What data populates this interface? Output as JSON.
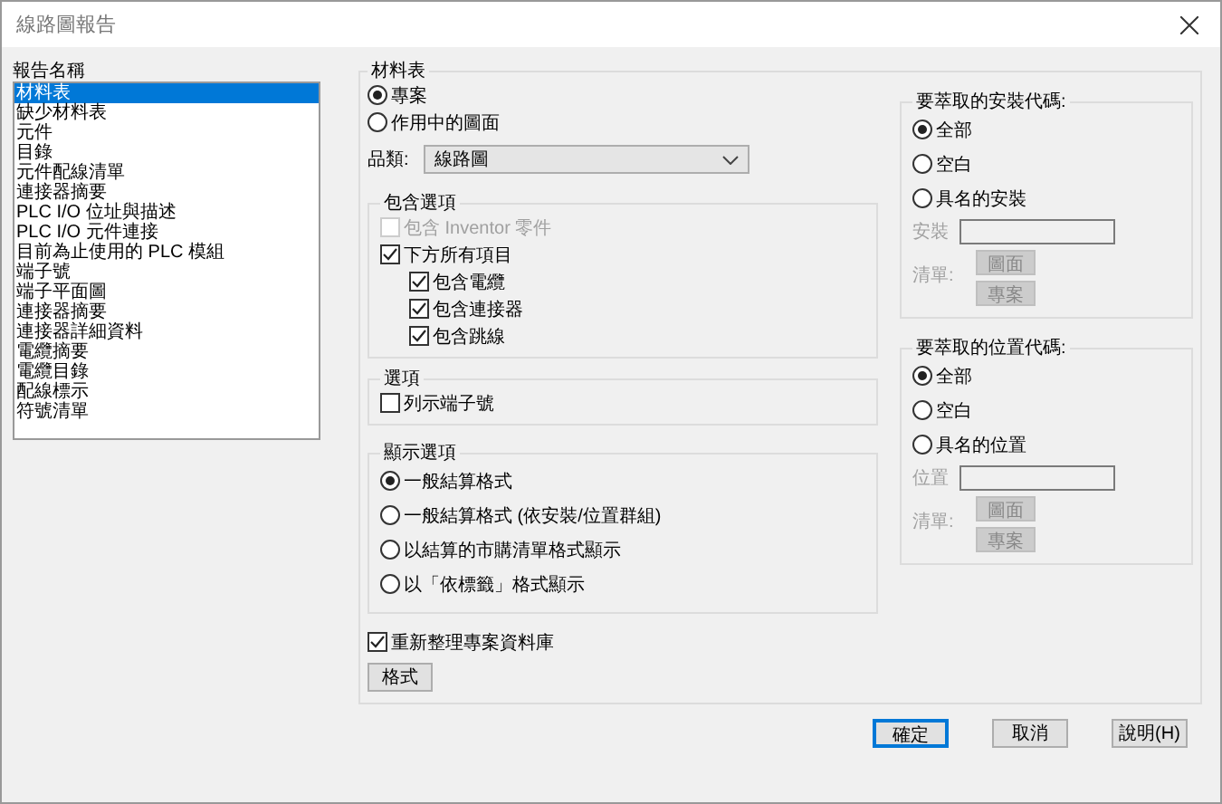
{
  "window": {
    "title": "線路圖報告"
  },
  "report_list": {
    "label": "報告名稱",
    "items": [
      {
        "label": "材料表",
        "selected": true
      },
      {
        "label": "缺少材料表",
        "selected": false
      },
      {
        "label": "元件",
        "selected": false
      },
      {
        "label": "目錄",
        "selected": false
      },
      {
        "label": "元件配線清單",
        "selected": false
      },
      {
        "label": "連接器摘要",
        "selected": false
      },
      {
        "label": "PLC I/O 位址與描述",
        "selected": false
      },
      {
        "label": "PLC I/O 元件連接",
        "selected": false
      },
      {
        "label": "目前為止使用的 PLC 模組",
        "selected": false
      },
      {
        "label": "端子號",
        "selected": false
      },
      {
        "label": "端子平面圖",
        "selected": false
      },
      {
        "label": "連接器摘要",
        "selected": false
      },
      {
        "label": "連接器詳細資料",
        "selected": false
      },
      {
        "label": "電纜摘要",
        "selected": false
      },
      {
        "label": "電纜目錄",
        "selected": false
      },
      {
        "label": "配線標示",
        "selected": false
      },
      {
        "label": "符號清單",
        "selected": false
      }
    ]
  },
  "bom": {
    "title": "材料表",
    "scope": [
      {
        "label": "專案",
        "selected": true
      },
      {
        "label": "作用中的圖面",
        "selected": false
      }
    ],
    "category": {
      "label": "品類:",
      "value": "線路圖"
    },
    "include": {
      "title": "包含選項",
      "items": [
        {
          "label": "包含 Inventor 零件",
          "checked": false,
          "disabled": true
        },
        {
          "label": "下方所有項目",
          "checked": true,
          "disabled": false,
          "children": [
            {
              "label": "包含電纜",
              "checked": true,
              "disabled": false
            },
            {
              "label": "包含連接器",
              "checked": true,
              "disabled": false
            },
            {
              "label": "包含跳線",
              "checked": true,
              "disabled": false
            }
          ]
        }
      ]
    },
    "options": {
      "title": "選項",
      "items": [
        {
          "label": "列示端子號",
          "checked": false
        }
      ]
    },
    "display": {
      "title": "顯示選項",
      "items": [
        {
          "label": "一般結算格式",
          "selected": true
        },
        {
          "label": "一般結算格式 (依安裝/位置群組)",
          "selected": false
        },
        {
          "label": "以結算的市購清單格式顯示",
          "selected": false
        },
        {
          "label": "以「依標籤」格式顯示",
          "selected": false
        }
      ]
    },
    "update_db": {
      "label": "重新整理專案資料庫",
      "checked": true
    },
    "format_button": "格式",
    "filters": [
      {
        "title": "要萃取的安裝代碼:",
        "choices": [
          {
            "label": "全部",
            "selected": true
          },
          {
            "label": "空白",
            "selected": false
          },
          {
            "label": "具名的安裝",
            "selected": false
          }
        ],
        "field_label": "安裝",
        "list_label": "清單:",
        "buttons": [
          "圖面",
          "專案"
        ],
        "disabled": true
      },
      {
        "title": "要萃取的位置代碼:",
        "choices": [
          {
            "label": "全部",
            "selected": true
          },
          {
            "label": "空白",
            "selected": false
          },
          {
            "label": "具名的位置",
            "selected": false
          }
        ],
        "field_label": "位置",
        "list_label": "清單:",
        "buttons": [
          "圖面",
          "專案"
        ],
        "disabled": true
      }
    ]
  },
  "buttons": [
    {
      "label": "確定",
      "default": true
    },
    {
      "label": "取消",
      "default": false
    },
    {
      "label": "說明(H)",
      "default": false
    }
  ]
}
